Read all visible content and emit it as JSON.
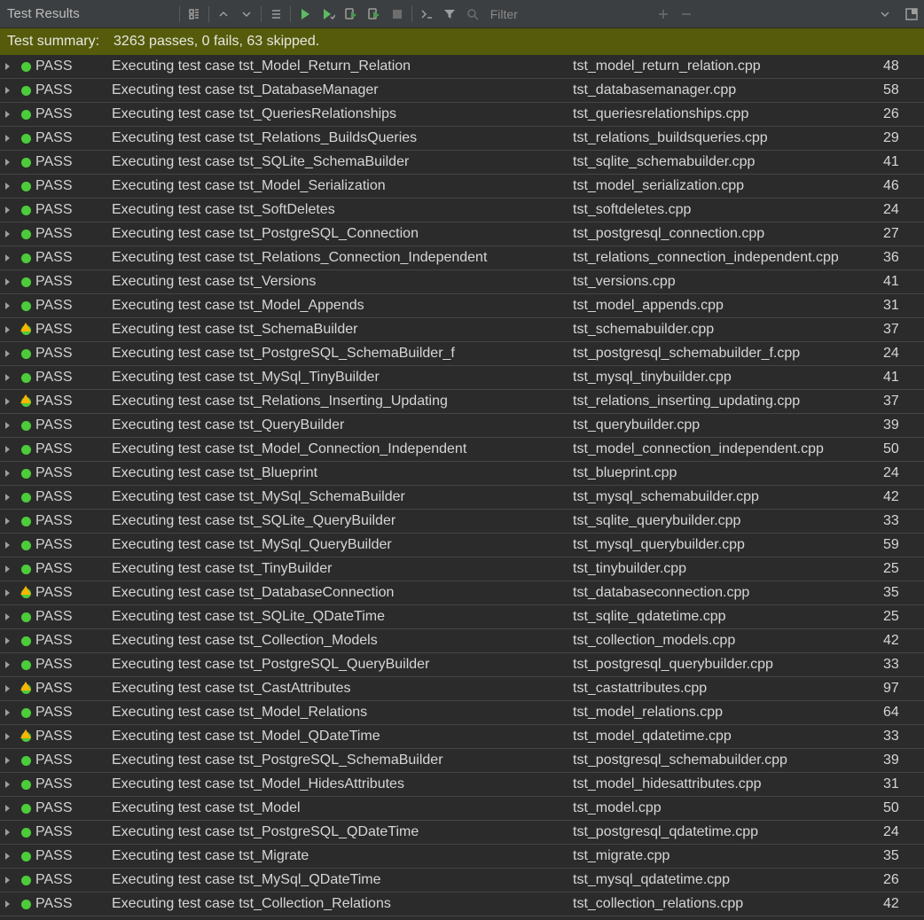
{
  "panel": {
    "title": "Test Results"
  },
  "toolbar": {
    "filter_placeholder": "Filter"
  },
  "summary": {
    "label": "Test summary:",
    "value": "3263 passes, 0 fails, 63 skipped."
  },
  "status_label": {
    "pass": "PASS"
  },
  "colors": {
    "pass": "#4ccc3a",
    "warn": "#ffb400",
    "summary_bg": "#555b0b",
    "toolbar_bg": "#3c3f41",
    "bg": "#2b2b2b",
    "row_border": "#454545",
    "text": "#d6d6d6"
  },
  "results": [
    {
      "status": "pass",
      "warn": false,
      "desc": "Executing test case tst_Model_Return_Relation",
      "file": "tst_model_return_relation.cpp",
      "count": 48
    },
    {
      "status": "pass",
      "warn": false,
      "desc": "Executing test case tst_DatabaseManager",
      "file": "tst_databasemanager.cpp",
      "count": 58
    },
    {
      "status": "pass",
      "warn": false,
      "desc": "Executing test case tst_QueriesRelationships",
      "file": "tst_queriesrelationships.cpp",
      "count": 26
    },
    {
      "status": "pass",
      "warn": false,
      "desc": "Executing test case tst_Relations_BuildsQueries",
      "file": "tst_relations_buildsqueries.cpp",
      "count": 29
    },
    {
      "status": "pass",
      "warn": false,
      "desc": "Executing test case tst_SQLite_SchemaBuilder",
      "file": "tst_sqlite_schemabuilder.cpp",
      "count": 41
    },
    {
      "status": "pass",
      "warn": false,
      "desc": "Executing test case tst_Model_Serialization",
      "file": "tst_model_serialization.cpp",
      "count": 46
    },
    {
      "status": "pass",
      "warn": false,
      "desc": "Executing test case tst_SoftDeletes",
      "file": "tst_softdeletes.cpp",
      "count": 24
    },
    {
      "status": "pass",
      "warn": false,
      "desc": "Executing test case tst_PostgreSQL_Connection",
      "file": "tst_postgresql_connection.cpp",
      "count": 27
    },
    {
      "status": "pass",
      "warn": false,
      "desc": "Executing test case tst_Relations_Connection_Independent",
      "file": "tst_relations_connection_independent.cpp",
      "count": 36
    },
    {
      "status": "pass",
      "warn": false,
      "desc": "Executing test case tst_Versions",
      "file": "tst_versions.cpp",
      "count": 41
    },
    {
      "status": "pass",
      "warn": false,
      "desc": "Executing test case tst_Model_Appends",
      "file": "tst_model_appends.cpp",
      "count": 31
    },
    {
      "status": "pass",
      "warn": true,
      "desc": "Executing test case tst_SchemaBuilder",
      "file": "tst_schemabuilder.cpp",
      "count": 37
    },
    {
      "status": "pass",
      "warn": false,
      "desc": "Executing test case tst_PostgreSQL_SchemaBuilder_f",
      "file": "tst_postgresql_schemabuilder_f.cpp",
      "count": 24
    },
    {
      "status": "pass",
      "warn": false,
      "desc": "Executing test case tst_MySql_TinyBuilder",
      "file": "tst_mysql_tinybuilder.cpp",
      "count": 41
    },
    {
      "status": "pass",
      "warn": true,
      "desc": "Executing test case tst_Relations_Inserting_Updating",
      "file": "tst_relations_inserting_updating.cpp",
      "count": 37
    },
    {
      "status": "pass",
      "warn": false,
      "desc": "Executing test case tst_QueryBuilder",
      "file": "tst_querybuilder.cpp",
      "count": 39
    },
    {
      "status": "pass",
      "warn": false,
      "desc": "Executing test case tst_Model_Connection_Independent",
      "file": "tst_model_connection_independent.cpp",
      "count": 50
    },
    {
      "status": "pass",
      "warn": false,
      "desc": "Executing test case tst_Blueprint",
      "file": "tst_blueprint.cpp",
      "count": 24
    },
    {
      "status": "pass",
      "warn": false,
      "desc": "Executing test case tst_MySql_SchemaBuilder",
      "file": "tst_mysql_schemabuilder.cpp",
      "count": 42
    },
    {
      "status": "pass",
      "warn": false,
      "desc": "Executing test case tst_SQLite_QueryBuilder",
      "file": "tst_sqlite_querybuilder.cpp",
      "count": 33
    },
    {
      "status": "pass",
      "warn": false,
      "desc": "Executing test case tst_MySql_QueryBuilder",
      "file": "tst_mysql_querybuilder.cpp",
      "count": 59
    },
    {
      "status": "pass",
      "warn": false,
      "desc": "Executing test case tst_TinyBuilder",
      "file": "tst_tinybuilder.cpp",
      "count": 25
    },
    {
      "status": "pass",
      "warn": true,
      "desc": "Executing test case tst_DatabaseConnection",
      "file": "tst_databaseconnection.cpp",
      "count": 35
    },
    {
      "status": "pass",
      "warn": false,
      "desc": "Executing test case tst_SQLite_QDateTime",
      "file": "tst_sqlite_qdatetime.cpp",
      "count": 25
    },
    {
      "status": "pass",
      "warn": false,
      "desc": "Executing test case tst_Collection_Models",
      "file": "tst_collection_models.cpp",
      "count": 42
    },
    {
      "status": "pass",
      "warn": false,
      "desc": "Executing test case tst_PostgreSQL_QueryBuilder",
      "file": "tst_postgresql_querybuilder.cpp",
      "count": 33
    },
    {
      "status": "pass",
      "warn": true,
      "desc": "Executing test case tst_CastAttributes",
      "file": "tst_castattributes.cpp",
      "count": 97
    },
    {
      "status": "pass",
      "warn": false,
      "desc": "Executing test case tst_Model_Relations",
      "file": "tst_model_relations.cpp",
      "count": 64
    },
    {
      "status": "pass",
      "warn": true,
      "desc": "Executing test case tst_Model_QDateTime",
      "file": "tst_model_qdatetime.cpp",
      "count": 33
    },
    {
      "status": "pass",
      "warn": false,
      "desc": "Executing test case tst_PostgreSQL_SchemaBuilder",
      "file": "tst_postgresql_schemabuilder.cpp",
      "count": 39
    },
    {
      "status": "pass",
      "warn": false,
      "desc": "Executing test case tst_Model_HidesAttributes",
      "file": "tst_model_hidesattributes.cpp",
      "count": 31
    },
    {
      "status": "pass",
      "warn": false,
      "desc": "Executing test case tst_Model",
      "file": "tst_model.cpp",
      "count": 50
    },
    {
      "status": "pass",
      "warn": false,
      "desc": "Executing test case tst_PostgreSQL_QDateTime",
      "file": "tst_postgresql_qdatetime.cpp",
      "count": 24
    },
    {
      "status": "pass",
      "warn": false,
      "desc": "Executing test case tst_Migrate",
      "file": "tst_migrate.cpp",
      "count": 35
    },
    {
      "status": "pass",
      "warn": false,
      "desc": "Executing test case tst_MySql_QDateTime",
      "file": "tst_mysql_qdatetime.cpp",
      "count": 26
    },
    {
      "status": "pass",
      "warn": false,
      "desc": "Executing test case tst_Collection_Relations",
      "file": "tst_collection_relations.cpp",
      "count": 42
    }
  ]
}
